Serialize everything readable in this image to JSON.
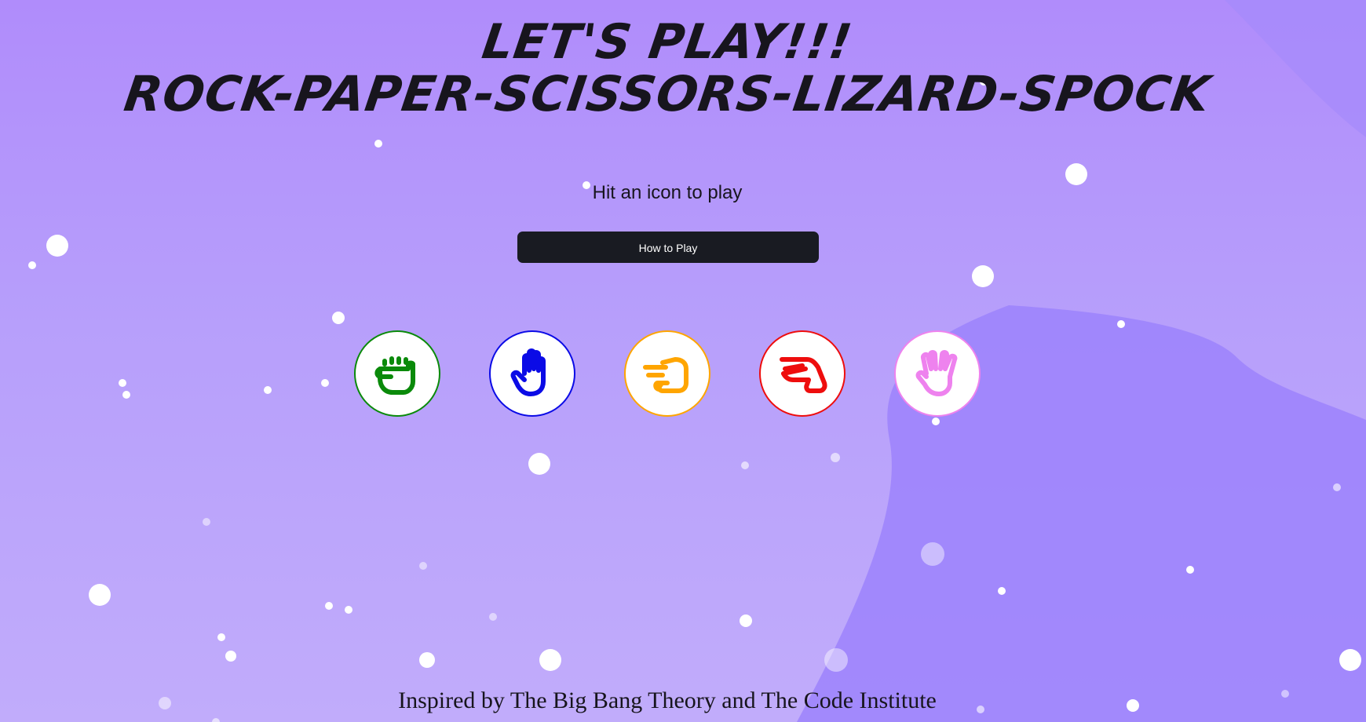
{
  "header": {
    "title_line1": "LET'S PLAY!!!",
    "title_line2": "ROCK-PAPER-SCISSORS-LIZARD-SPOCK"
  },
  "prompt": "Hit an icon to play",
  "how_to_play_button": "How to Play",
  "choices": [
    {
      "name": "rock",
      "icon": "fist-icon",
      "color": "#0a8a0a"
    },
    {
      "name": "paper",
      "icon": "open-hand-icon",
      "color": "#0b0be6"
    },
    {
      "name": "scissors",
      "icon": "scissors-hand-icon",
      "color": "#ffa500"
    },
    {
      "name": "lizard",
      "icon": "lizard-hand-icon",
      "color": "#ee0d0d"
    },
    {
      "name": "spock",
      "icon": "vulcan-salute-icon",
      "color": "#ee82ee"
    }
  ],
  "footer": "Inspired by The Big Bang Theory and The Code Institute",
  "colors": {
    "background": "#b79ffb",
    "background_blob": "#9b82fb",
    "text": "#17151d",
    "button": "#191b22"
  }
}
